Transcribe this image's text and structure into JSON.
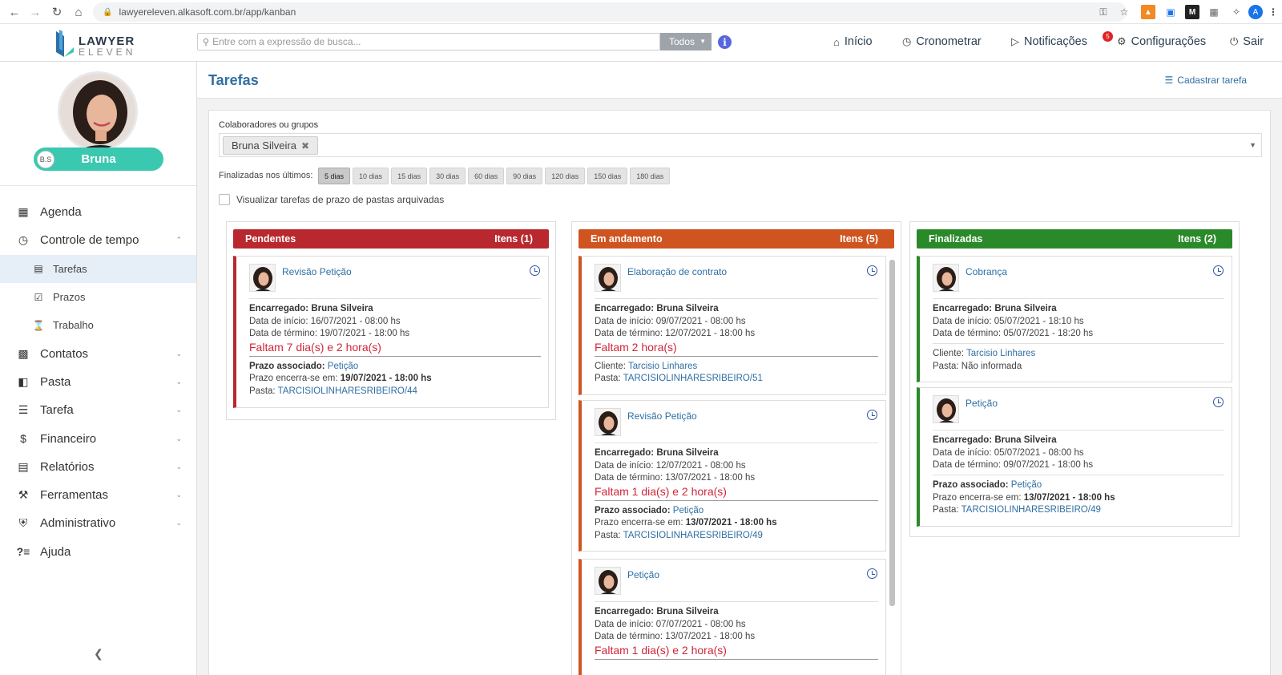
{
  "browser": {
    "url": "lawyereleven.alkasoft.com.br/app/kanban",
    "profile_initial": "A"
  },
  "header": {
    "logo_top": "LAWYER",
    "logo_bottom": "ELEVEN",
    "search_placeholder": "Entre com a expressão de busca...",
    "search_scope": "Todos",
    "nav": {
      "inicio": "Início",
      "cronometrar": "Cronometrar",
      "notificacoes": "Notificações",
      "notif_count": "5",
      "configuracoes": "Configurações",
      "sair": "Sair"
    }
  },
  "user": {
    "initials": "B.S",
    "name": "Bruna"
  },
  "sidebar": {
    "items": [
      {
        "label": "Agenda"
      },
      {
        "label": "Controle de tempo"
      },
      {
        "label": "Tarefas"
      },
      {
        "label": "Prazos"
      },
      {
        "label": "Trabalho"
      },
      {
        "label": "Contatos"
      },
      {
        "label": "Pasta"
      },
      {
        "label": "Tarefa"
      },
      {
        "label": "Financeiro"
      },
      {
        "label": "Relatórios"
      },
      {
        "label": "Ferramentas"
      },
      {
        "label": "Administrativo"
      },
      {
        "label": "Ajuda"
      }
    ]
  },
  "page": {
    "title": "Tarefas",
    "add_task": "Cadastrar tarefa",
    "colab_label": "Colaboradores ou grupos",
    "colab_tag": "Bruna Silveira",
    "finalizadas_label": "Finalizadas nos últimos:",
    "days": [
      "5 dias",
      "10 dias",
      "15 dias",
      "30 dias",
      "60 dias",
      "90 dias",
      "120 dias",
      "150 dias",
      "180 dias"
    ],
    "archived_label": "Visualizar tarefas de prazo de pastas arquivadas"
  },
  "columns": [
    {
      "title": "Pendentes",
      "count": "Itens (1)",
      "color": "#b8282e",
      "cards": [
        {
          "title": "Revisão Petição",
          "encarregado_label": "Encarregado:",
          "encarregado": "Bruna Silveira",
          "inicio": "Data de início: 16/07/2021 - 08:00 hs",
          "termino": "Data de término: 19/07/2021 - 18:00 hs",
          "faltam": "Faltam 7 dia(s) e 2 hora(s)",
          "prazo_label": "Prazo associado:",
          "prazo": "Petição",
          "encerra_label": "Prazo encerra-se em:",
          "encerra": "19/07/2021 - 18:00 hs",
          "pasta_label": "Pasta:",
          "pasta": "TARCISIOLINHARESRIBEIRO/44"
        }
      ]
    },
    {
      "title": "Em andamento",
      "count": "Itens (5)",
      "color": "#d0541f",
      "cards": [
        {
          "title": "Elaboração de contrato",
          "encarregado_label": "Encarregado:",
          "encarregado": "Bruna Silveira",
          "inicio": "Data de início: 09/07/2021 - 08:00 hs",
          "termino": "Data de término: 12/07/2021 - 18:00 hs",
          "faltam": "Faltam 2 hora(s)",
          "cliente_label": "Cliente:",
          "cliente": "Tarcisio Linhares",
          "pasta_label": "Pasta:",
          "pasta": "TARCISIOLINHARESRIBEIRO/51"
        },
        {
          "title": "Revisão Petição",
          "encarregado_label": "Encarregado:",
          "encarregado": "Bruna Silveira",
          "inicio": "Data de início: 12/07/2021 - 08:00 hs",
          "termino": "Data de término: 13/07/2021 - 18:00 hs",
          "faltam": "Faltam 1 dia(s) e 2 hora(s)",
          "prazo_label": "Prazo associado:",
          "prazo": "Petição",
          "encerra_label": "Prazo encerra-se em:",
          "encerra": "13/07/2021 - 18:00 hs",
          "pasta_label": "Pasta:",
          "pasta": "TARCISIOLINHARESRIBEIRO/49"
        },
        {
          "title": "Petição",
          "encarregado_label": "Encarregado:",
          "encarregado": "Bruna Silveira",
          "inicio": "Data de início: 07/07/2021 - 08:00 hs",
          "termino": "Data de término: 13/07/2021 - 18:00 hs",
          "faltam": "Faltam 1 dia(s) e 2 hora(s)"
        }
      ]
    },
    {
      "title": "Finalizadas",
      "count": "Itens (2)",
      "color": "#2a8a2a",
      "cards": [
        {
          "title": "Cobrança",
          "encarregado_label": "Encarregado:",
          "encarregado": "Bruna Silveira",
          "inicio": "Data de início: 05/07/2021 - 18:10 hs",
          "termino": "Data de término: 05/07/2021 - 18:20 hs",
          "cliente_label": "Cliente:",
          "cliente": "Tarcisio Linhares",
          "pasta_text": "Pasta: Não informada"
        },
        {
          "title": "Petição",
          "encarregado_label": "Encarregado:",
          "encarregado": "Bruna Silveira",
          "inicio": "Data de início: 05/07/2021 - 08:00 hs",
          "termino": "Data de término: 09/07/2021 - 18:00 hs",
          "prazo_label": "Prazo associado:",
          "prazo": "Petição",
          "encerra_label": "Prazo encerra-se em:",
          "encerra": "13/07/2021 - 18:00 hs",
          "pasta_label": "Pasta:",
          "pasta": "TARCISIOLINHARESRIBEIRO/49"
        }
      ]
    }
  ]
}
